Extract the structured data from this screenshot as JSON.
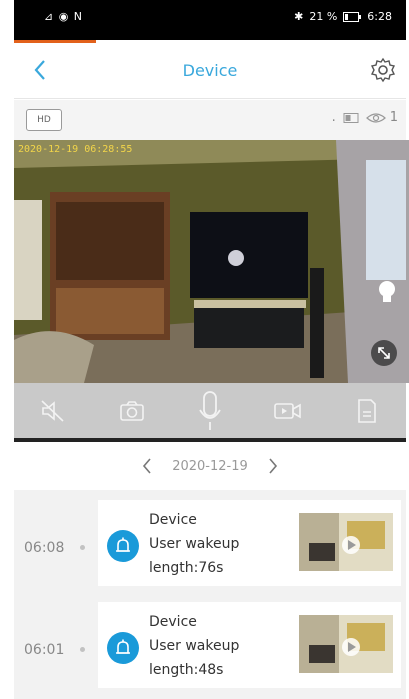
{
  "status_bar": {
    "left": "⊿ ◉ N",
    "bluetooth": "✱",
    "battery_text": "21 %",
    "time": "6:28"
  },
  "header": {
    "title": "Device"
  },
  "quality": {
    "hd_label": "HD",
    "dot": ".",
    "viewer_count": "1"
  },
  "video": {
    "timestamp": "2020-12-19 06:28:55"
  },
  "date_nav": {
    "date": "2020-12-19"
  },
  "events": [
    {
      "time": "06:08",
      "device": "Device",
      "type": "User wakeup",
      "length": "length:76s"
    },
    {
      "time": "06:01",
      "device": "Device",
      "type": "User wakeup",
      "length": "length:48s"
    }
  ],
  "colors": {
    "accent": "#3aa8dc",
    "tab_indicator": "#e2611b",
    "event_icon": "#1a9ad9"
  }
}
